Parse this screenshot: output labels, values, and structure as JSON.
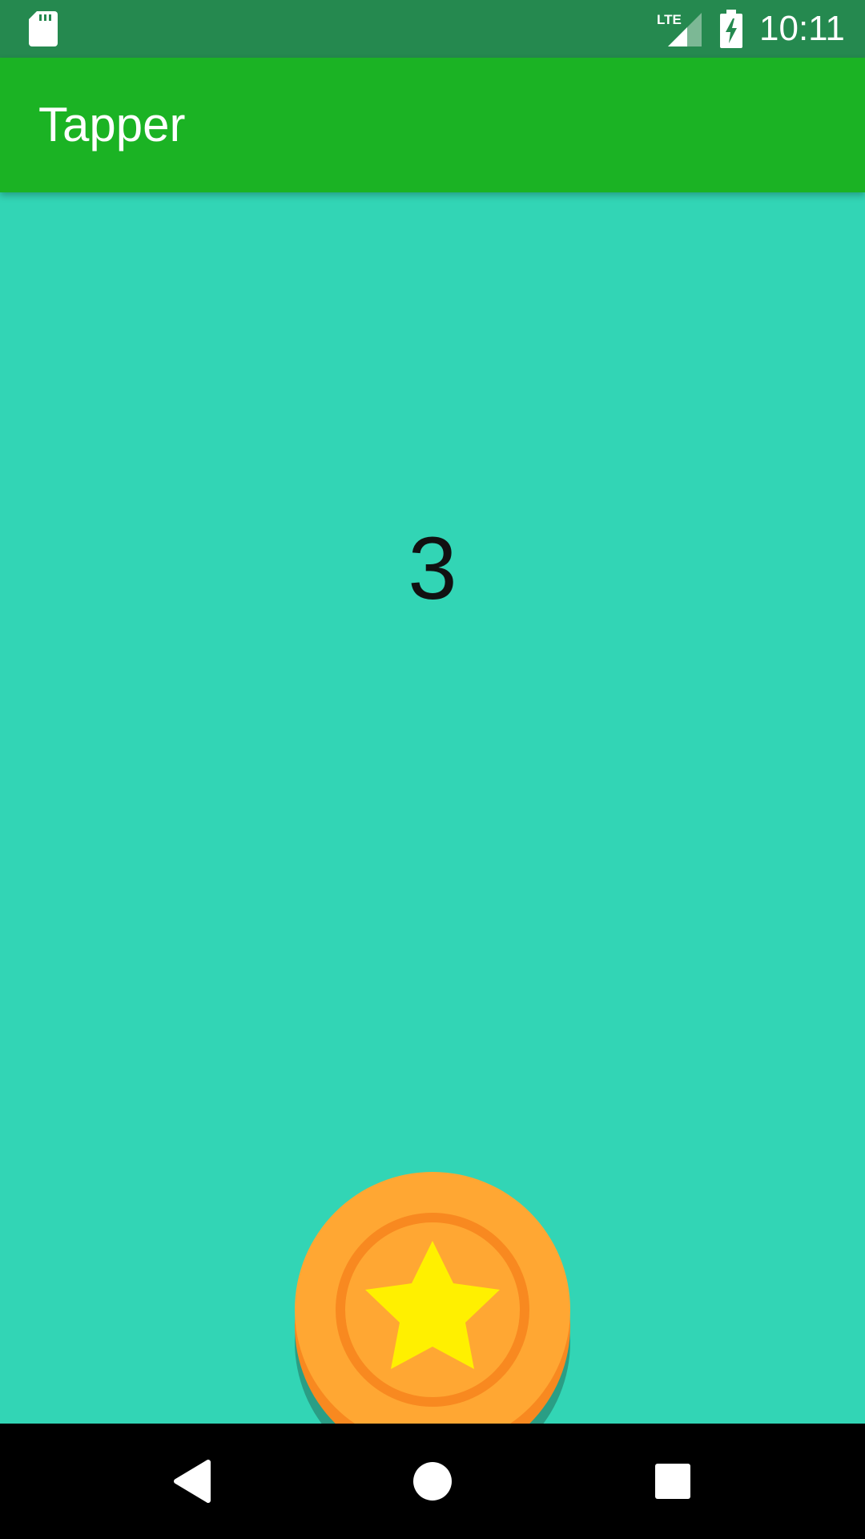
{
  "status_bar": {
    "time": "10:11",
    "lte_label": "LTE",
    "icons": [
      "sd-card-icon",
      "lte-signal-icon",
      "battery-charging-icon"
    ]
  },
  "app_bar": {
    "title": "Tapper"
  },
  "main": {
    "tap_count": "3",
    "coin_button_icon": "star-coin-icon"
  },
  "nav_bar": {
    "buttons": [
      "back-icon",
      "home-icon",
      "recents-icon"
    ]
  },
  "colors": {
    "status_bar": "#25894F",
    "app_bar": "#1BB324",
    "background": "#32D5B5",
    "coin_face": "#FFA733",
    "coin_ring": "#F88920",
    "coin_star": "#FFF000",
    "coin_shadow": "#2A9E85",
    "nav_bar": "#000000"
  }
}
